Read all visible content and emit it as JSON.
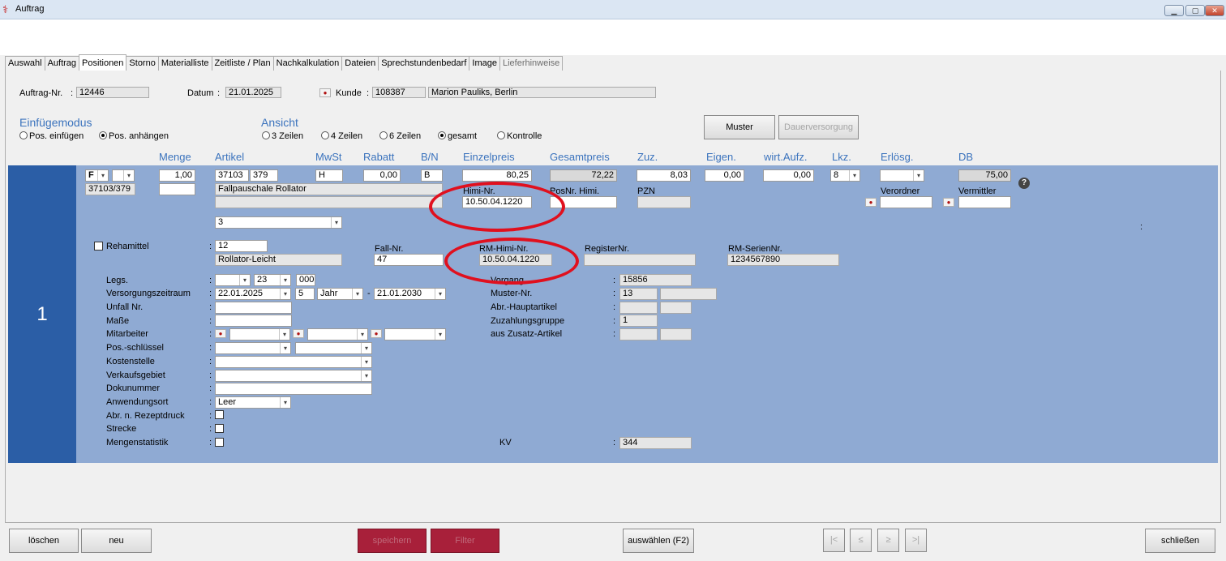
{
  "window": {
    "title": "Auftrag",
    "icon": "app-logo-icon",
    "controls": [
      "minimize-icon",
      "maximize-icon",
      "close-icon"
    ]
  },
  "tabs": [
    "Auswahl",
    "Auftrag",
    "Positionen",
    "Storno",
    "Materialliste",
    "Zeitliste / Plan",
    "Nachkalkulation",
    "Dateien",
    "Sprechstundenbedarf",
    "Image",
    "Lieferhinweise"
  ],
  "active_tab": "Positionen",
  "header": {
    "auftrag_label": "Auftrag-Nr.",
    "auftrag_value": "12446",
    "datum_label": "Datum",
    "datum_value": "21.01.2025",
    "kunde_label": "Kunde",
    "kunde_id": "108387",
    "kunde_name": "Marion Pauliks, Berlin",
    "colon": ":"
  },
  "einfuegemodus": {
    "title": "Einfügemodus",
    "opt1": "Pos. einfügen",
    "opt2": "Pos. anhängen",
    "selected": "Pos. anhängen"
  },
  "ansicht": {
    "title": "Ansicht",
    "opt1": "3 Zeilen",
    "opt2": "4 Zeilen",
    "opt3": "6 Zeilen",
    "opt4": "gesamt",
    "opt5": "Kontrolle",
    "selected": "gesamt"
  },
  "buttons_top": {
    "muster": "Muster",
    "dauer": "Dauerversorgung"
  },
  "columns": {
    "menge": "Menge",
    "artikel": "Artikel",
    "mwst": "MwSt",
    "rabatt": "Rabatt",
    "bn": "B/N",
    "einzelpreis": "Einzelpreis",
    "gesamtpreis": "Gesamtpreis",
    "zuz": "Zuz.",
    "eigen": "Eigen.",
    "wirt": "wirt.Aufz.",
    "lkz": "Lkz.",
    "erloesg": "Erlösg.",
    "db": "DB"
  },
  "position": {
    "row_number": "1",
    "fn": "F",
    "menge": "1,00",
    "artikel1": "37103",
    "artikel2": "379",
    "mwst": "H",
    "rabatt": "0,00",
    "bn": "B",
    "einzelpreis": "80,25",
    "gesamtpreis": "72,22",
    "zuz": "8,03",
    "eigen": "0,00",
    "wirt": "0,00",
    "lkz": "8",
    "db": "75,00",
    "artno": "37103/379",
    "bezeichnung": "Fallpauschale Rollator",
    "himi_label": "Himi-Nr.",
    "himi_value": "10.50.04.1220",
    "posnr_label": "PosNr. Himi.",
    "pzn_label": "PZN",
    "verordner_label": "Verordner",
    "vermittler_label": "Vermittler",
    "combo3": "3",
    "colon_right": ":"
  },
  "details": {
    "rehamittel_label": "Rehamittel",
    "reha_value": "12",
    "reha_name": "Rollator-Leicht",
    "fallnr_label": "Fall-Nr.",
    "fallnr_value": "47",
    "rmhimi_label": "RM-Himi-Nr.",
    "rmhimi_value": "10.50.04.1220",
    "registernr_label": "RegisterNr.",
    "rmserien_label": "RM-SerienNr.",
    "rmserien_value": "1234567890",
    "legs_label": "Legs.",
    "legs_num": "23",
    "legs_code": "000",
    "versorgung_label": "Versorgungszeitraum",
    "vz_from": "22.01.2025",
    "vz_count": "5",
    "vz_unit": "Jahr",
    "vz_dash": "-",
    "vz_to": "21.01.2030",
    "unfall_label": "Unfall Nr.",
    "masse_label": "Maße",
    "mitarbeiter_label": "Mitarbeiter",
    "posschluessel_label": "Pos.-schlüssel",
    "kostenstelle_label": "Kostenstelle",
    "verkaufsgebiet_label": "Verkaufsgebiet",
    "dokunummer_label": "Dokunummer",
    "anwendungsort_label": "Anwendungsort",
    "anwendungsort_value": "Leer",
    "abr_label": "Abr. n. Rezeptdruck",
    "strecke_label": "Strecke",
    "mengenstatistik_label": "Mengenstatistik",
    "vorgang_label": "Vorgang",
    "vorgang_value": "15856",
    "musternr_label": "Muster-Nr.",
    "musternr_value": "13",
    "abrhaupt_label": "Abr.-Hauptartikel",
    "zuzahlung_label": "Zuzahlungsgruppe",
    "zuzahlung_value": "1",
    "zusatz_label": "aus Zusatz-Artikel",
    "kv_label": "KV",
    "kv_value": "344"
  },
  "bottom_buttons": {
    "loeschen": "löschen",
    "neu": "neu",
    "speichern": "speichern",
    "filter": "Filter",
    "auswaehlen": "auswählen (F2)",
    "first": "|<",
    "prev": "≤",
    "next": "≥",
    "last": ">|",
    "schliessen": "schließen"
  },
  "colors": {
    "row_panel": "#8faad3",
    "row_number_bg": "#2b5ea6",
    "header_blue": "#3b73bd",
    "disabled_red": "#a8203a",
    "annotation_ring": "#e0101e"
  }
}
